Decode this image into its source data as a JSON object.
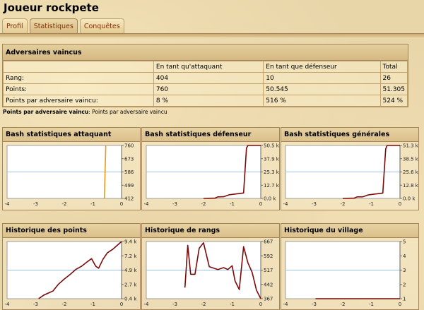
{
  "page_title": "Joueur rockpete",
  "tabs": [
    {
      "label": "Profil"
    },
    {
      "label": "Statistiques"
    },
    {
      "label": "Conquêtes"
    }
  ],
  "table": {
    "header": "Adversaires vaincus",
    "col_headers": [
      "",
      "En tant qu'attaquant",
      "En tant que défenseur",
      "Total"
    ],
    "rows": [
      {
        "label": "Rang:",
        "attaquant": "404",
        "defenseur": "10",
        "total": "26"
      },
      {
        "label": "Points:",
        "attaquant": "760",
        "defenseur": "50.545",
        "total": "51.305"
      },
      {
        "label": "Points par adversaire vaincu:",
        "attaquant": "8 %",
        "defenseur": "516 %",
        "total": "524 %"
      }
    ]
  },
  "legend": {
    "bold": "Points par adversaire vaincu",
    "text": ": Points par adversaire vaincu"
  },
  "colors": {
    "line": "#7a0a0a",
    "line_orange": "#e89a1f",
    "grid": "#9dc3e6",
    "bg": "#ffffff"
  },
  "chart_data": [
    {
      "type": "line",
      "title": "Bash statistiques attaquant",
      "x_ticks": [
        "-4",
        "-3",
        "-2",
        "-1",
        "0"
      ],
      "y_ticks": [
        "760",
        "673",
        "586",
        "499",
        "412"
      ],
      "xlim": [
        -4,
        0
      ],
      "ylim": [
        412,
        760
      ],
      "color_key": "line_orange",
      "series": [
        {
          "x": [
            -0.6,
            -0.55
          ],
          "y": [
            412,
            760
          ]
        }
      ]
    },
    {
      "type": "line",
      "title": "Bash statistiques défenseur",
      "x_ticks": [
        "-4",
        "-3",
        "-2",
        "-1",
        "0"
      ],
      "y_ticks": [
        "50.5 k",
        "37.9 k",
        "25.3 k",
        "12.7 k",
        "0.0 k"
      ],
      "xlim": [
        -4,
        0
      ],
      "ylim": [
        0,
        50.5
      ],
      "color_key": "line",
      "series": [
        {
          "x": [
            -2.0,
            -1.6,
            -1.5,
            -1.3,
            -1.1,
            -0.8,
            -0.6,
            -0.5,
            -0.45,
            -0.3,
            -0.1,
            0
          ],
          "y": [
            0,
            0.3,
            1.5,
            1.6,
            3.5,
            4.5,
            5.2,
            48,
            50.5,
            50.5,
            50.5,
            50.5
          ]
        }
      ]
    },
    {
      "type": "line",
      "title": "Bash statistiques générales",
      "x_ticks": [
        "-4",
        "-3",
        "-2",
        "-1",
        "0"
      ],
      "y_ticks": [
        "51.3 k",
        "38.5 k",
        "25.6 k",
        "12.8 k",
        "0.0 k"
      ],
      "xlim": [
        -4,
        0
      ],
      "ylim": [
        0,
        51.3
      ],
      "color_key": "line",
      "series": [
        {
          "x": [
            -2.0,
            -1.6,
            -1.5,
            -1.3,
            -1.1,
            -0.8,
            -0.6,
            -0.5,
            -0.45,
            -0.3,
            -0.1,
            0
          ],
          "y": [
            0,
            0.3,
            1.5,
            1.6,
            3.5,
            4.5,
            5.2,
            48,
            51.3,
            51.3,
            51.3,
            51.3
          ]
        }
      ]
    },
    {
      "type": "line",
      "title": "Historique des points",
      "x_ticks": [
        "-4",
        "-3",
        "-2",
        "-1",
        "0"
      ],
      "y_ticks": [
        "9.4 k",
        "7.2 k",
        "4.9 k",
        "2.7 k",
        "0.4 k"
      ],
      "xlim": [
        -4,
        0
      ],
      "ylim": [
        0.4,
        9.4
      ],
      "color_key": "line",
      "series": [
        {
          "x": [
            -2.9,
            -2.7,
            -2.55,
            -2.4,
            -2.2,
            -2.0,
            -1.8,
            -1.6,
            -1.4,
            -1.2,
            -1.05,
            -0.9,
            -0.8,
            -0.65,
            -0.5,
            -0.3,
            -0.1,
            0
          ],
          "y": [
            0.4,
            1.0,
            1.3,
            1.6,
            2.7,
            3.5,
            4.2,
            5.0,
            5.5,
            6.2,
            6.7,
            5.5,
            5.2,
            6.6,
            7.6,
            8.2,
            9.0,
            9.4
          ]
        }
      ]
    },
    {
      "type": "line",
      "title": "Historique de rangs",
      "x_ticks": [
        "-4",
        "-3",
        "-2",
        "-1",
        "0"
      ],
      "y_ticks": [
        "667",
        "592",
        "517",
        "442",
        "367"
      ],
      "xlim": [
        -4,
        0
      ],
      "ylim": [
        367,
        667
      ],
      "color_key": "line",
      "series": [
        {
          "x": [
            -2.65,
            -2.55,
            -2.45,
            -2.3,
            -2.15,
            -2.0,
            -1.8,
            -1.5,
            -1.3,
            -1.15,
            -1.0,
            -0.9,
            -0.75,
            -0.6,
            -0.45,
            -0.3,
            -0.15,
            0
          ],
          "y": [
            425,
            647,
            495,
            495,
            632,
            660,
            535,
            520,
            530,
            520,
            540,
            460,
            415,
            640,
            555,
            505,
            412,
            367
          ]
        }
      ]
    },
    {
      "type": "line",
      "title": "Historique du village",
      "x_ticks": [
        "-4",
        "-3",
        "-2",
        "-1",
        "0"
      ],
      "y_ticks": [
        "5",
        "4",
        "3",
        "2",
        "1"
      ],
      "xlim": [
        -4,
        0
      ],
      "ylim": [
        1,
        5
      ],
      "color_key": "line",
      "series": [
        {
          "x": [
            -2.95,
            -1.5,
            0
          ],
          "y": [
            1,
            1,
            1
          ]
        }
      ]
    }
  ]
}
